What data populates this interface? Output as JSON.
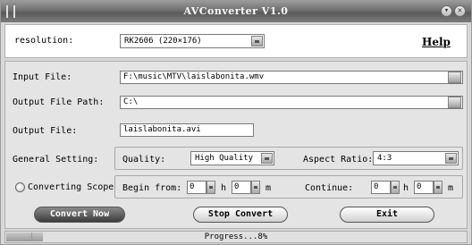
{
  "window": {
    "title": "AVConverter V1.0"
  },
  "top": {
    "resolution_label": "resolution:",
    "resolution_value": "RK2606 (220×176)",
    "help_label": "Help"
  },
  "files": {
    "input_label": "Input File:",
    "input_value": "F:\\music\\MTV\\laislabonita.wmv",
    "output_path_label": "Output File Path:",
    "output_path_value": "C:\\",
    "output_file_label": "Output File:",
    "output_file_value": "laislabonita.avi"
  },
  "general": {
    "label": "General Setting:",
    "quality_label": "Quality:",
    "quality_value": "High Quality",
    "aspect_label": "Aspect Ratio:",
    "aspect_value": "4:3"
  },
  "scope": {
    "label": "Converting Scope:",
    "begin_label": "Begin from:",
    "begin_h": "0",
    "begin_m": "0",
    "h_unit": "h",
    "m_unit": "m",
    "continue_label": "Continue:",
    "continue_h": "0",
    "continue_m": "0"
  },
  "buttons": {
    "convert": "Convert Now",
    "stop": "Stop Convert",
    "exit": "Exit"
  },
  "status": {
    "text": "Progress...8%",
    "progress_fraction": 0.08
  },
  "icons": {
    "title_left": "grip-icon",
    "minimize": "minimize-icon",
    "close": "close-icon"
  }
}
